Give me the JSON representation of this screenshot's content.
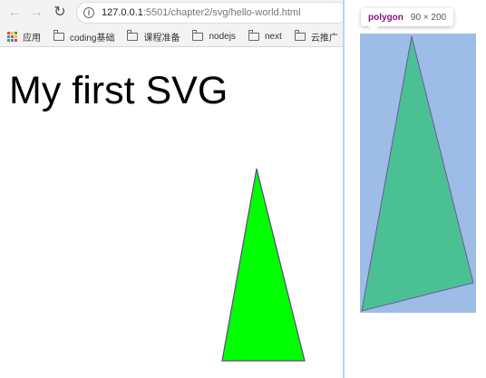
{
  "browser": {
    "url_host": "127.0.0.1",
    "url_path": ":5501/chapter2/svg/hello-world.html",
    "nav_icons": {
      "back": "arrow-left-icon",
      "forward": "arrow-right-icon",
      "reload": "reload-icon",
      "info": "info-icon"
    },
    "bookmarks": [
      {
        "label": "应用",
        "icon": "apps-icon"
      },
      {
        "label": "coding基础",
        "icon": "folder-icon"
      },
      {
        "label": "课程准备",
        "icon": "folder-icon"
      },
      {
        "label": "nodejs",
        "icon": "folder-icon"
      },
      {
        "label": "next",
        "icon": "folder-icon"
      },
      {
        "label": "云推广",
        "icon": "folder-icon"
      }
    ]
  },
  "page": {
    "heading": "My first SVG",
    "polygon_fill": "#00ff00",
    "polygon_stroke": "#6b3f86"
  },
  "inspector": {
    "tag": "polygon",
    "size": "90 × 200",
    "highlight_color": "#9dbde6",
    "polygon_fill": "#4cc095",
    "tag_color": "#881280"
  },
  "colors": {
    "toolbar_bg": "#f3f3f3",
    "divider": "#bcd3f2"
  }
}
